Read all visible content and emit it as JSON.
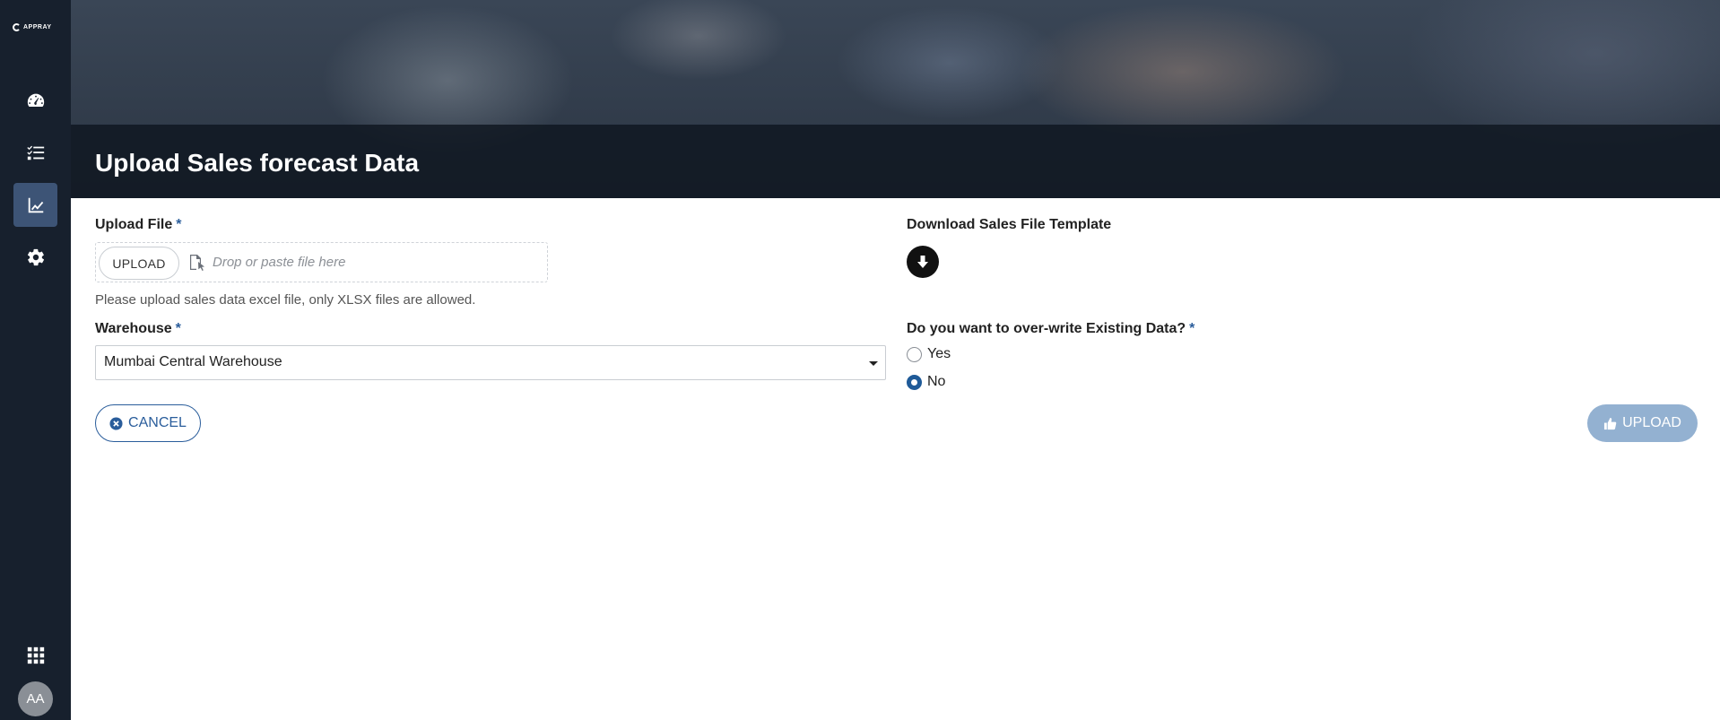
{
  "sidebar": {
    "logo_text": "APPRAY",
    "items": [
      {
        "name": "dashboard",
        "icon": "speedometer-icon",
        "active": false
      },
      {
        "name": "tasks",
        "icon": "checklist-icon",
        "active": false
      },
      {
        "name": "forecast",
        "icon": "line-chart-icon",
        "active": true
      },
      {
        "name": "settings",
        "icon": "gear-icon",
        "active": false
      }
    ],
    "apps_icon": "grid-apps-icon",
    "avatar_initials": "AA"
  },
  "page": {
    "title": "Upload Sales forecast Data"
  },
  "form": {
    "upload_file": {
      "label": "Upload File",
      "required_mark": "*",
      "button_label": "UPLOAD",
      "drop_placeholder": "Drop or paste file here",
      "hint": "Please upload sales data excel file, only XLSX files are allowed."
    },
    "warehouse": {
      "label": "Warehouse",
      "required_mark": "*",
      "selected_value": "Mumbai Central Warehouse"
    },
    "template": {
      "label": "Download Sales File Template",
      "icon": "download-arrow-icon"
    },
    "overwrite": {
      "label": "Do you want to over-write Existing Data?",
      "required_mark": "*",
      "options": [
        {
          "label": "Yes",
          "checked": false
        },
        {
          "label": "No",
          "checked": true
        }
      ]
    },
    "actions": {
      "cancel_label": "CANCEL",
      "upload_label": "UPLOAD"
    }
  },
  "colors": {
    "sidebar_bg": "#17202d",
    "sidebar_active": "#3d5476",
    "accent": "#2a5d9b",
    "upload_disabled": "#93b1d1"
  }
}
